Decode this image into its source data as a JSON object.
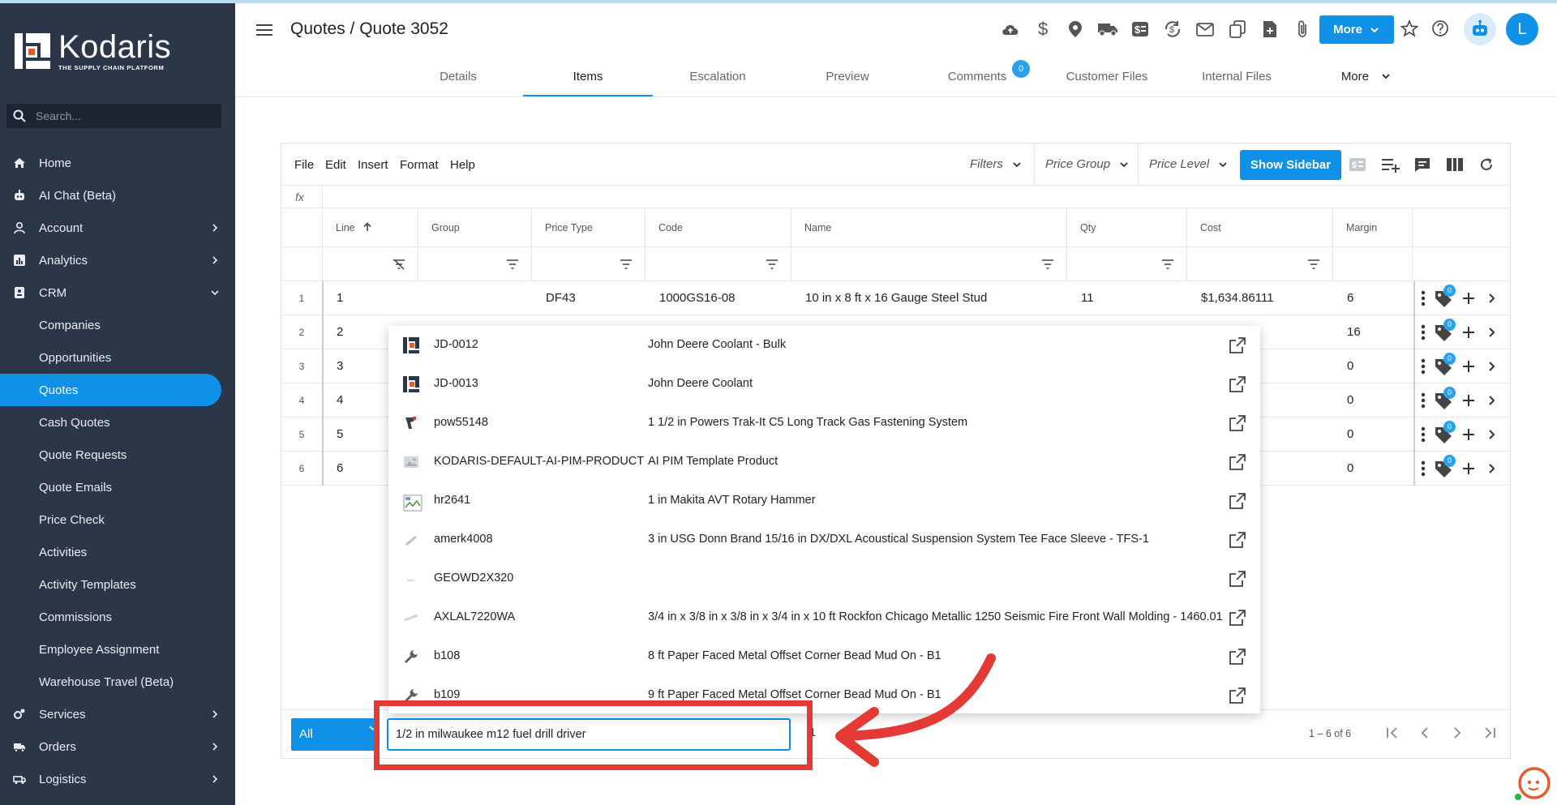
{
  "app": {
    "logo_name": "Kodaris",
    "logo_tagline": "THE SUPPLY CHAIN PLATFORM"
  },
  "sidebar": {
    "search_placeholder": "Search...",
    "items": [
      {
        "label": "Home",
        "icon": "home-icon"
      },
      {
        "label": "AI Chat (Beta)",
        "icon": "robot-icon"
      },
      {
        "label": "Account",
        "icon": "user-icon",
        "chevron": "right"
      },
      {
        "label": "Analytics",
        "icon": "analytics-icon",
        "chevron": "right"
      },
      {
        "label": "CRM",
        "icon": "crm-icon",
        "chevron": "down"
      },
      {
        "label": "Companies",
        "sub": true
      },
      {
        "label": "Opportunities",
        "sub": true
      },
      {
        "label": "Quotes",
        "sub": true,
        "active": true
      },
      {
        "label": "Cash Quotes",
        "sub": true
      },
      {
        "label": "Quote Requests",
        "sub": true
      },
      {
        "label": "Quote Emails",
        "sub": true
      },
      {
        "label": "Price Check",
        "sub": true
      },
      {
        "label": "Activities",
        "sub": true
      },
      {
        "label": "Activity Templates",
        "sub": true
      },
      {
        "label": "Commissions",
        "sub": true
      },
      {
        "label": "Employee Assignment",
        "sub": true
      },
      {
        "label": "Warehouse Travel (Beta)",
        "sub": true
      },
      {
        "label": "Services",
        "icon": "services-icon",
        "chevron": "right"
      },
      {
        "label": "Orders",
        "icon": "truck-icon",
        "chevron": "right"
      },
      {
        "label": "Logistics",
        "icon": "logistics-icon",
        "chevron": "right"
      }
    ]
  },
  "header": {
    "title": "Quotes / Quote 3052",
    "more_label": "More",
    "avatar_initial": "L"
  },
  "tabs": [
    {
      "label": "Details"
    },
    {
      "label": "Items",
      "active": true
    },
    {
      "label": "Escalation"
    },
    {
      "label": "Preview"
    },
    {
      "label": "Comments",
      "badge": "0"
    },
    {
      "label": "Customer Files"
    },
    {
      "label": "Internal Files"
    },
    {
      "label": "More"
    }
  ],
  "toolbar": {
    "menus": [
      "File",
      "Edit",
      "Insert",
      "Format",
      "Help"
    ],
    "filters": "Filters",
    "price_group": "Price Group",
    "price_level": "Price Level",
    "show_sidebar": "Show Sidebar",
    "fx": "fx"
  },
  "grid": {
    "columns": [
      "Line",
      "Group",
      "Price Type",
      "Code",
      "Name",
      "Qty",
      "Cost",
      "Margin"
    ],
    "rows": [
      {
        "num": "1",
        "line": "1",
        "price_type": "DF43",
        "code": "1000GS16-08",
        "name": "10 in x 8 ft x 16 Gauge Steel Stud",
        "qty": "11",
        "cost": "$1,634.86111",
        "margin": "6",
        "tag_badge": "0"
      },
      {
        "num": "2",
        "line": "2",
        "margin": "16",
        "tag_badge": "0"
      },
      {
        "num": "3",
        "line": "3",
        "margin": "0",
        "tag_badge": "0"
      },
      {
        "num": "4",
        "line": "4",
        "margin": "0",
        "tag_badge": "0"
      },
      {
        "num": "5",
        "line": "5",
        "margin": "0",
        "tag_badge": "0"
      },
      {
        "num": "6",
        "line": "6",
        "margin": "0",
        "tag_badge": "0"
      }
    ]
  },
  "dropdown": [
    {
      "code": "JD-0012",
      "name": "John Deere Coolant - Bulk",
      "thumb": "kodaris"
    },
    {
      "code": "JD-0013",
      "name": "John Deere Coolant",
      "thumb": "kodaris"
    },
    {
      "code": "pow55148",
      "name": "1 1/2 in Powers Trak-It C5 Long Track Gas Fastening System",
      "thumb": "tool"
    },
    {
      "code": "KODARIS-DEFAULT-AI-PIM-PRODUCT",
      "name": "AI PIM Template Product",
      "thumb": "image"
    },
    {
      "code": "hr2641",
      "name": "1 in Makita AVT Rotary Hammer",
      "thumb": "broken"
    },
    {
      "code": "amerk4008",
      "name": "3 in USG Donn Brand 15/16 in DX/DXL Acoustical Suspension System Tee Face Sleeve - TFS-1",
      "thumb": "part"
    },
    {
      "code": "GEOWD2X320",
      "name": "",
      "thumb": "part"
    },
    {
      "code": "AXLAL7220WA",
      "name": "3/4 in x 3/8 in x 3/8 in x 3/4 in x 10 ft Rockfon Chicago Metallic 1250 Seismic Fire Front Wall Molding - 1460.01",
      "thumb": "part"
    },
    {
      "code": "b108",
      "name": "8 ft Paper Faced Metal Offset Corner Bead Mud On - B1",
      "thumb": "wrench"
    },
    {
      "code": "b109",
      "name": "9 ft Paper Faced Metal Offset Corner Bead Mud On - B1",
      "thumb": "wrench"
    }
  ],
  "footer": {
    "scope": "All",
    "entry_value": "1/2 in milwaukee m12 fuel drill driver",
    "qty_value": "1",
    "pager_text": "1 – 6 of 6"
  },
  "colors": {
    "accent": "#0f91e8",
    "sidebar": "#2b3648",
    "annotation": "#e53935"
  }
}
